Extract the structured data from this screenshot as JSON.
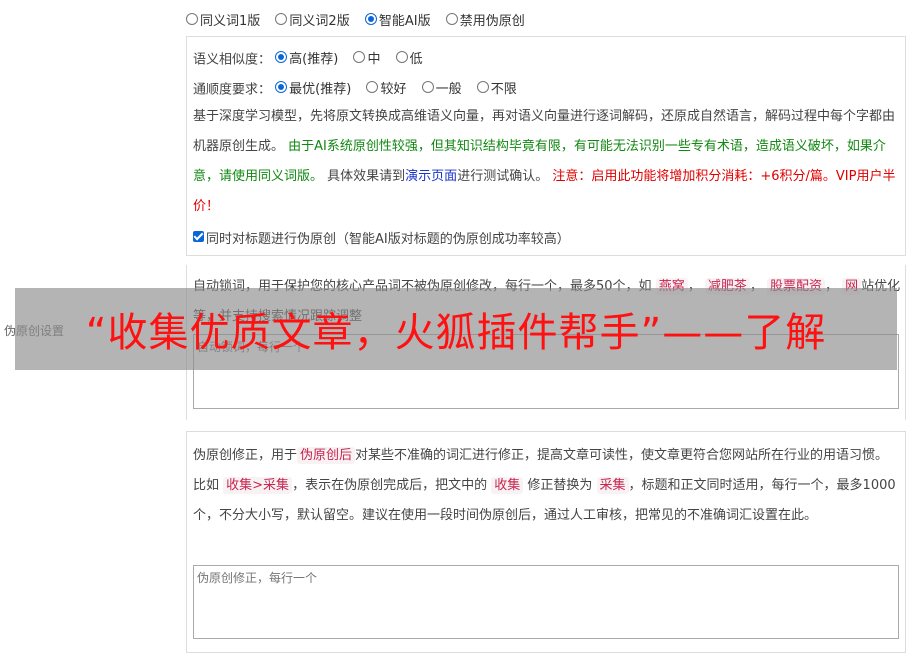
{
  "version_options": [
    {
      "label": "同义词1版",
      "checked": false
    },
    {
      "label": "同义词2版",
      "checked": false
    },
    {
      "label": "智能AI版",
      "checked": true
    },
    {
      "label": "禁用伪原创",
      "checked": false
    }
  ],
  "similarity": {
    "label": "语义相似度：",
    "options": [
      {
        "label": "高(推荐)",
        "checked": true
      },
      {
        "label": "中",
        "checked": false
      },
      {
        "label": "低",
        "checked": false
      }
    ]
  },
  "fluency": {
    "label": "通顺度要求：",
    "options": [
      {
        "label": "最优(推荐)",
        "checked": true
      },
      {
        "label": "较好",
        "checked": false
      },
      {
        "label": "一般",
        "checked": false
      },
      {
        "label": "不限",
        "checked": false
      }
    ]
  },
  "ai_desc": {
    "part1": "基于深度学习模型，先将原文转换成高维语义向量，再对语义向量进行逐词解码，还原成自然语言，解码过程中每个字都由机器原创生成。",
    "green": "由于AI系统原创性较强，但其知识结构毕竟有限，有可能无法识别一些专有术语，造成语义破坏，如果介意，请使用同义词版。",
    "part2": "具体效果请到",
    "link": "演示页面",
    "part3": "进行测试确认。",
    "red": "注意：启用此功能将增加积分消耗：+6积分/篇。VIP用户半价！"
  },
  "title_checkbox": {
    "label": "同时对标题进行伪原创（智能AI版对标题的伪原创成功率较高）",
    "checked": true
  },
  "lock_words": {
    "desc_a": "自动锁词，用于保护您的核心产品词不被伪原创修改，每行一个，最多50个，如",
    "examples": [
      "燕窝",
      "减肥茶",
      "股票配资",
      "网"
    ],
    "desc_b": "站优化等，并支持搜索情况跟踪调整",
    "placeholder": "自动锁词，每行一个"
  },
  "correction": {
    "desc_a": "伪原创修正，用于",
    "code1": "伪原创后",
    "desc_b": "对某些不准确的词汇进行修正，提高文章可读性，使文章更符合您网站所在行业的用语习惯。比如",
    "code2": "收集>采集",
    "desc_c": "，表示在伪原创完成后，把文中的",
    "code3": "收集",
    "desc_d": "修正替换为",
    "code4": "采集",
    "desc_e": "，标题和正文同时适用，每行一个，最多1000个，不分大小写，默认留空。建议在使用一段时间伪原创后，通过人工审核，把常见的不准确词汇设置在此。",
    "placeholder": "伪原创修正，每行一个"
  },
  "side_label": "伪原创设置",
  "banner": "“收集优质文章，火狐插件帮手”——了解"
}
